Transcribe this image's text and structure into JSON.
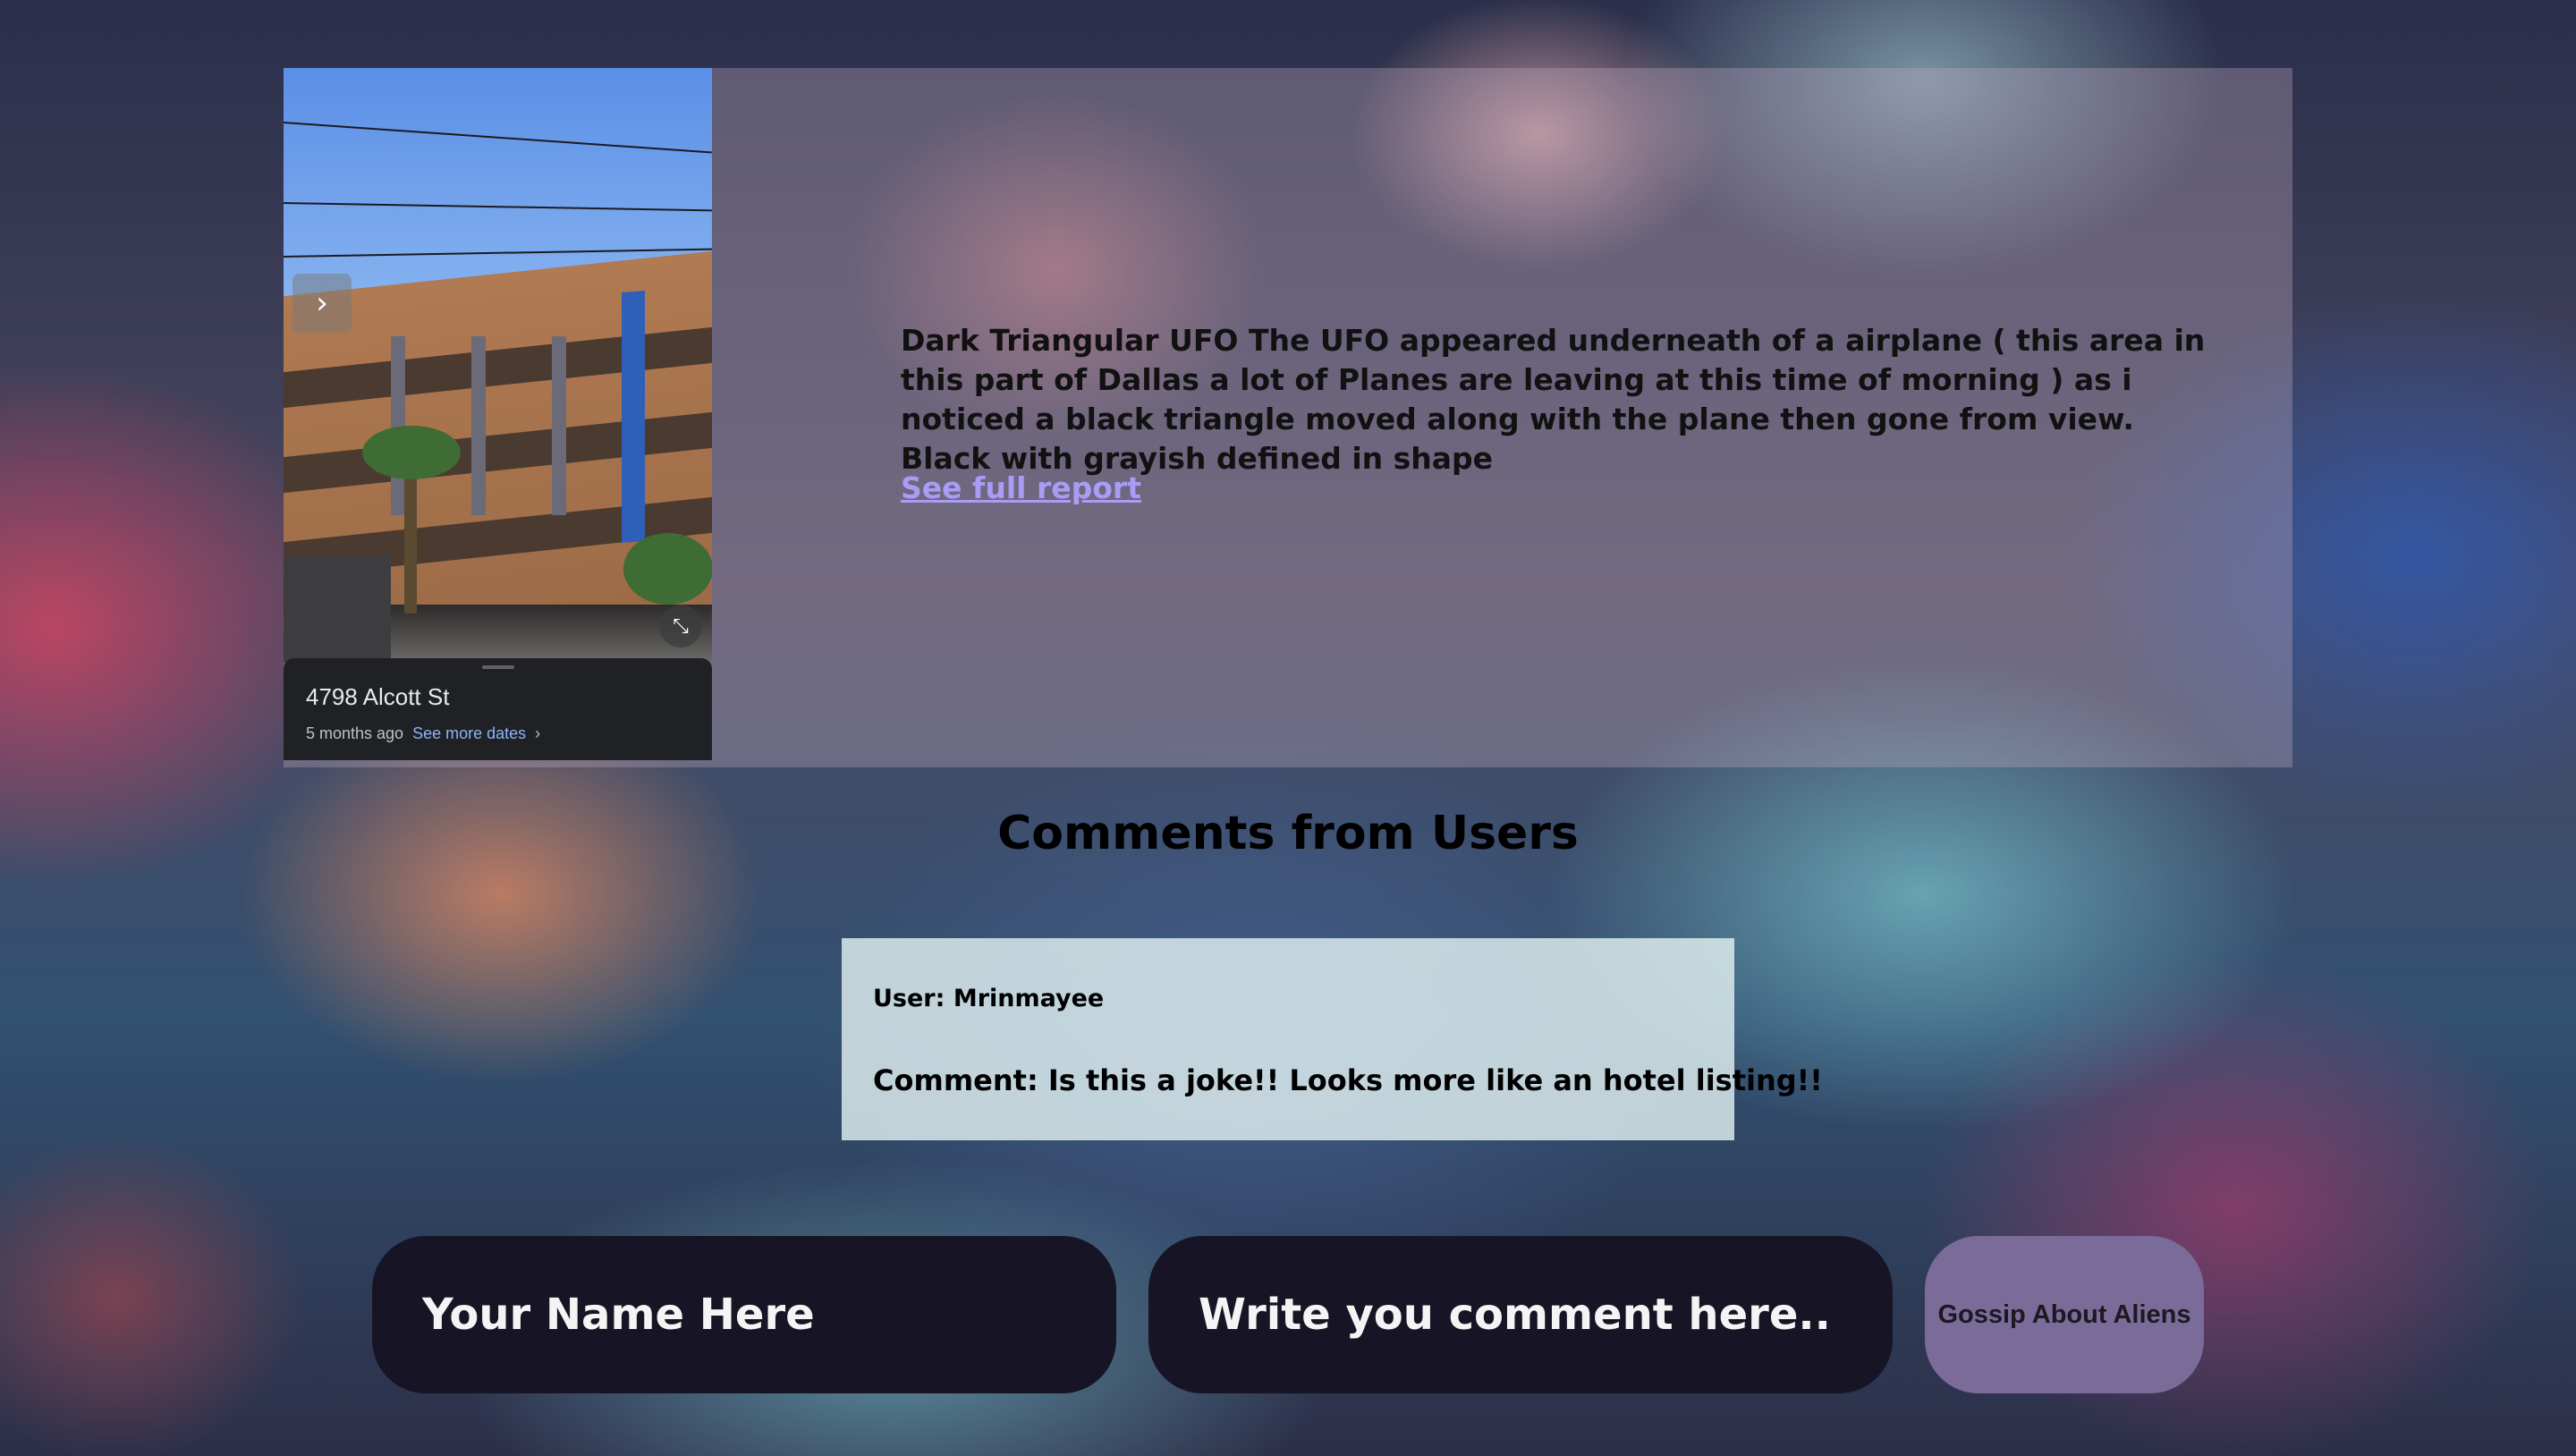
{
  "streetview": {
    "address": "4798 Alcott St",
    "age": "5 months ago",
    "more_dates_link": "See more dates",
    "chevron_glyph": "›",
    "nav_glyph": "›",
    "collapse_glyph": "⤡"
  },
  "report": {
    "description": "Dark Triangular UFO The UFO appeared underneath of a airplane ( this area in this part of Dallas a lot of Planes are leaving at this time of morning ) as i noticed a black triangle moved along with the plane then gone from view. Black with grayish defined in shape",
    "full_report_link": "See full report"
  },
  "comments": {
    "title": "Comments from Users",
    "items": [
      {
        "user": "User: Mrinmayee",
        "comment": "Comment: Is this a joke!! Looks more like an hotel listing!!"
      }
    ]
  },
  "form": {
    "name_placeholder": "Your Name Here",
    "comment_placeholder": "Write you comment here..",
    "submit_label": "Gossip About Aliens"
  },
  "colors": {
    "link": "#a99cf5",
    "input_bg": "#171525",
    "button_bg": "#7b6b99",
    "comment_card_bg": "#e1f0f0"
  }
}
